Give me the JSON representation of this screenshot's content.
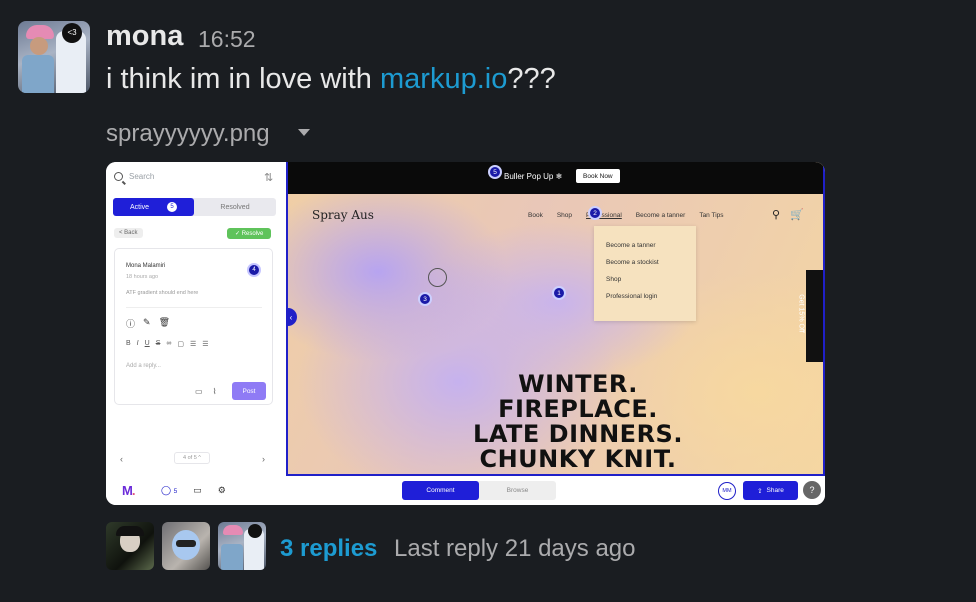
{
  "message": {
    "author": "mona",
    "time": "16:52",
    "text_before": "i think im in love with ",
    "link_text": "markup.io",
    "text_after": "???",
    "link_color": "#1d9bd1"
  },
  "attachment": {
    "filename": "sprayyyyyy.png"
  },
  "screenshot": {
    "left_panel": {
      "search_placeholder": "Search",
      "tab_active": "Active",
      "tab_active_count": "5",
      "tab_resolved": "Resolved",
      "back": "< Back",
      "resolve": "✓ Resolve",
      "comment": {
        "author": "Mona Malamiri",
        "time": "18 hours ago",
        "text": "ATF gradient should end here",
        "pin": "4",
        "reply_placeholder": "Add a reply...",
        "post": "Post"
      },
      "pager": "4 of 5 ^"
    },
    "site": {
      "promo_text": "Buller Pop Up ❄",
      "promo_button": "Book Now",
      "brand": "Spray Aus",
      "nav": [
        "Book",
        "Shop",
        "Professional",
        "Become a tanner",
        "Tan Tips"
      ],
      "dropdown": [
        "Become a tanner",
        "Become a stockist",
        "Shop",
        "Professional login"
      ],
      "side_tab": "Get 15% Off",
      "headline": [
        "WINTER.",
        "FIREPLACE.",
        "LATE DINNERS.",
        "CHUNKY KNIT."
      ],
      "pins": [
        "5",
        "2",
        "3",
        "1"
      ]
    },
    "toolbar": {
      "comment_count": "5",
      "comment": "Comment",
      "browse": "Browse",
      "avatar_initials": "MM",
      "share": "Share",
      "help": "?"
    },
    "accent_color": "#1f1fd8"
  },
  "thread": {
    "replies": "3 replies",
    "last_reply": "Last reply 21 days ago"
  }
}
